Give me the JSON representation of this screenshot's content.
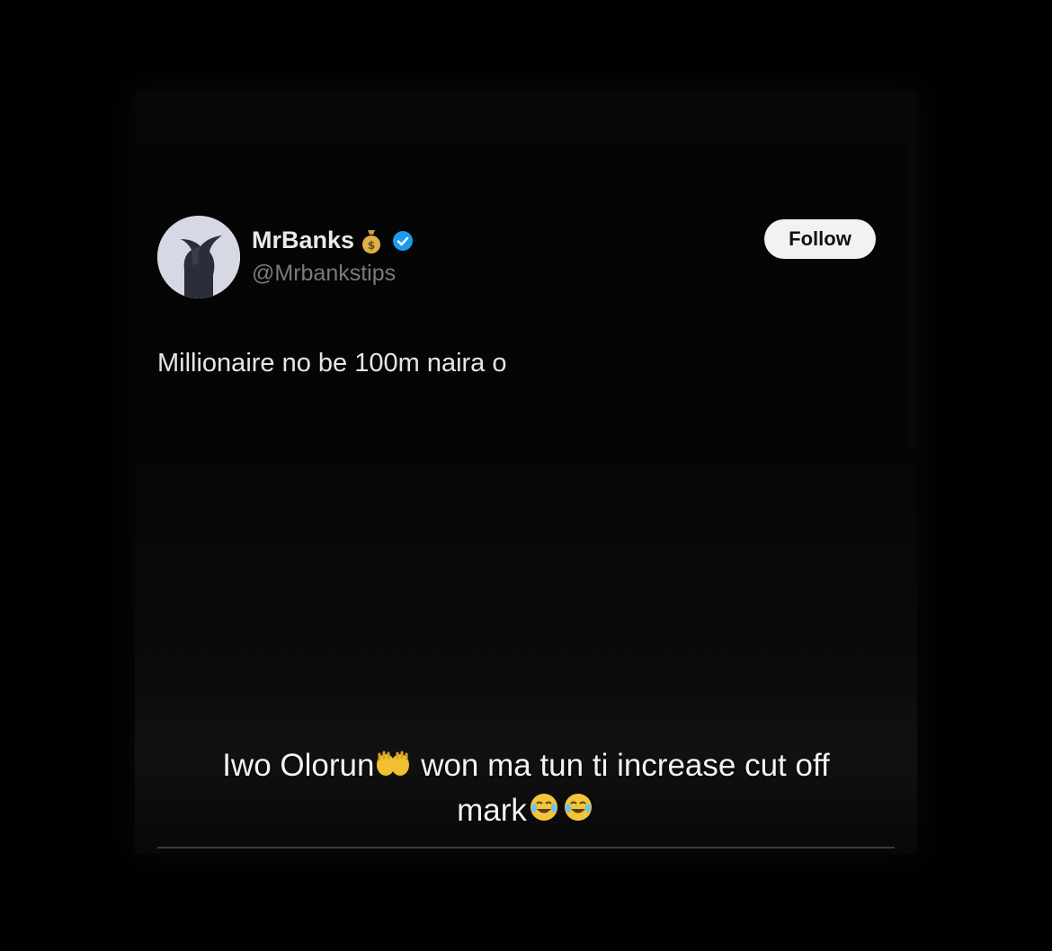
{
  "tweet": {
    "display_name": "MrBanks",
    "handle": "@Mrbankstips",
    "follow_label": "Follow",
    "text": "Millionaire no be 100m naira o",
    "name_badges": [
      "moneybag-icon",
      "verified-icon"
    ]
  },
  "caption": {
    "line1_part1": "Iwo Olorun",
    "line1_part2": "won ma tun ti increase cut off",
    "line2": "mark",
    "emojis": [
      "palms-up-icon",
      "tears-of-joy-icon",
      "tears-of-joy-icon"
    ]
  },
  "colors": {
    "background": "#000000",
    "verified_blue": "#1d9bf0",
    "follow_button": "#f2f2f2",
    "text_primary": "#e6e6e6",
    "text_secondary": "#7a7a7a"
  }
}
